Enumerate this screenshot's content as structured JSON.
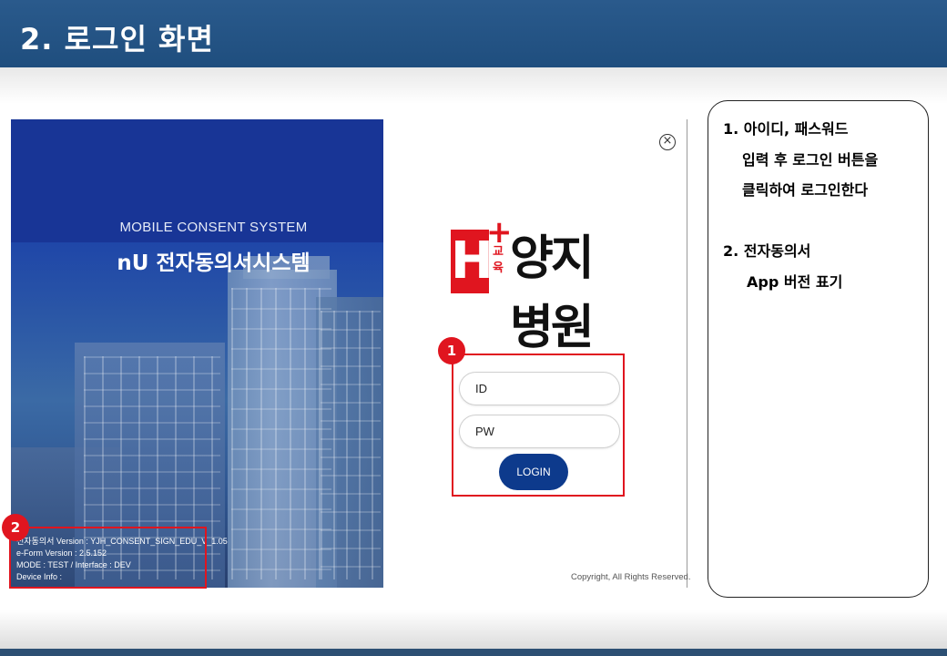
{
  "slide": {
    "title": "2. 로그인 화면"
  },
  "splash": {
    "subtitle": "MOBILE CONSENT SYSTEM",
    "title": "nU 전자동의서시스템",
    "version_lines": [
      "전자동의서 Version : YJH_CONSENT_SIGN_EDU_V_1.05",
      "e-Form Version : 2.5.152",
      "MODE : TEST / Interface : DEV",
      "Device Info :"
    ]
  },
  "login": {
    "close_icon": "close-circle-icon",
    "logo": {
      "h_letter": "H",
      "plus": "+",
      "edu": "교육",
      "name": "양지병원"
    },
    "id_placeholder": "ID",
    "pw_placeholder": "PW",
    "login_label": "LOGIN",
    "copyright": "Copyright, All Rights Reserved."
  },
  "badges": {
    "one": "1",
    "two": "2"
  },
  "description": {
    "item1_line1": "1.  아이디, 패스워드",
    "item1_line2": "입력 후 로그인 버튼을",
    "item1_line3": "클릭하여 로그인한다",
    "item2_line1": "2. 전자동의서",
    "item2_line2": "App 버전 표기"
  },
  "colors": {
    "header": "#1f4e7e",
    "highlight": "#e0151f",
    "login_button": "#0d3a8c"
  }
}
